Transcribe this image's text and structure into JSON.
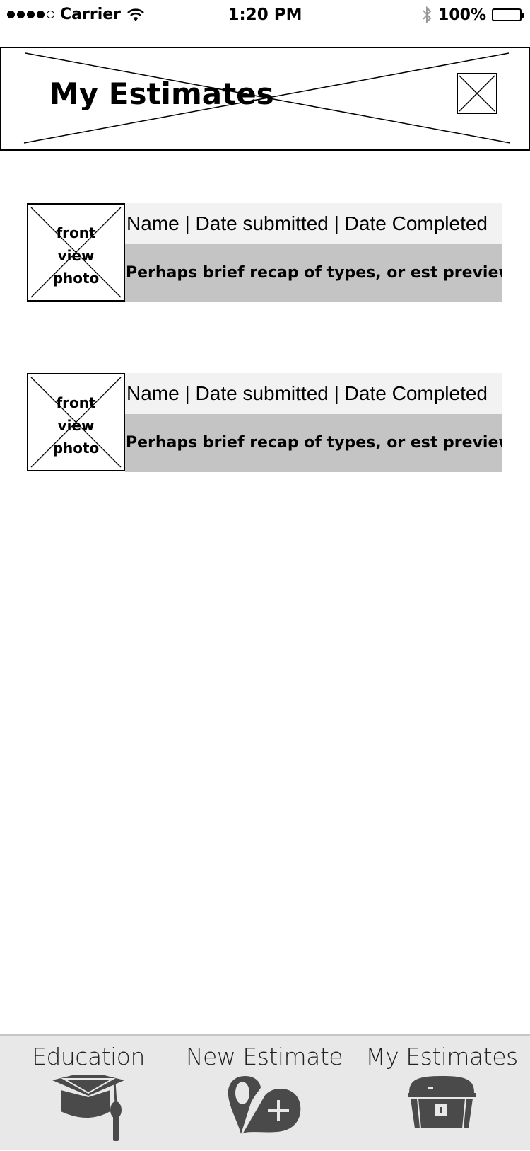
{
  "status_bar": {
    "signal_bars_filled": 4,
    "signal_bars_total": 5,
    "carrier": "Carrier",
    "wifi_icon": "wifi-icon",
    "time": "1:20 PM",
    "bluetooth_icon": "bluetooth-icon",
    "battery_percent": "100%",
    "battery_level": 1.0
  },
  "header": {
    "title": "My Estimates",
    "placeholder_icon": "image-placeholder-icon"
  },
  "estimates": [
    {
      "photo_label": [
        "front",
        "view",
        "photo"
      ],
      "title": "Name | Date submitted | Date Completed",
      "recap": "Perhaps brief recap of types, or est preview"
    },
    {
      "photo_label": [
        "front",
        "view",
        "photo"
      ],
      "title": "Name | Date submitted | Date Completed",
      "recap": "Perhaps brief recap of types, or est preview"
    }
  ],
  "tabbar": {
    "tabs": [
      {
        "label": "Education",
        "icon": "graduation-cap-icon"
      },
      {
        "label": "New Estimate",
        "icon": "map-pin-add-icon"
      },
      {
        "label": "My Estimates",
        "icon": "treasure-chest-icon"
      }
    ]
  },
  "colors": {
    "title_row_bg": "#f2f2f2",
    "recap_row_bg": "#c4c4c4",
    "tabbar_bg": "#e8e8e8",
    "icon_color": "#4a4a4a"
  }
}
